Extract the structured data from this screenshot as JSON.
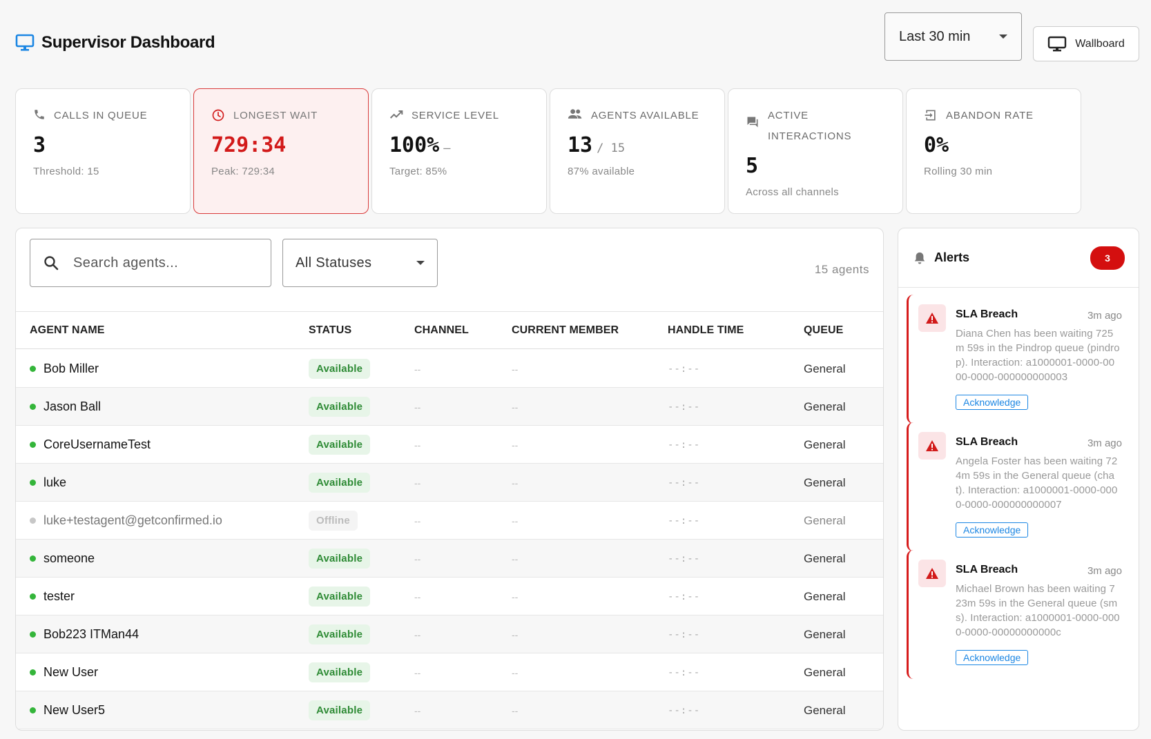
{
  "header": {
    "title": "Supervisor Dashboard",
    "time_range": "Last 30 min",
    "wallboard_label": "Wallboard"
  },
  "kpis": [
    {
      "label": "CALLS IN QUEUE",
      "value": "3",
      "secondary": "",
      "sub": "Threshold: 15",
      "icon": "phone-icon"
    },
    {
      "label": "LONGEST WAIT",
      "value": "729:34",
      "secondary": "",
      "sub": "Peak: 729:34",
      "icon": "clock-icon"
    },
    {
      "label": "SERVICE LEVEL",
      "value": "100%",
      "secondary": "–",
      "sub": "Target: 85%",
      "icon": "trend-icon"
    },
    {
      "label": "AGENTS AVAILABLE",
      "value": "13",
      "secondary": "/ 15",
      "sub": "87% available",
      "icon": "people-icon"
    },
    {
      "label": "ACTIVE INTERACTIONS",
      "value": "5",
      "secondary": "",
      "sub": "Across all channels",
      "icon": "chat-icon"
    },
    {
      "label": "ABANDON RATE",
      "value": "0%",
      "secondary": "",
      "sub": "Rolling 30 min",
      "icon": "exit-icon"
    }
  ],
  "agents": {
    "search_placeholder": "Search agents...",
    "status_filter": "All Statuses",
    "count_label": "15 agents",
    "columns": [
      "AGENT NAME",
      "STATUS",
      "CHANNEL",
      "CURRENT MEMBER",
      "HANDLE TIME",
      "QUEUE"
    ],
    "rows": [
      {
        "name": "Bob Miller",
        "status": "Available",
        "channel": "--",
        "member": "--",
        "handle": "--:--",
        "queue": "General"
      },
      {
        "name": "Jason Ball",
        "status": "Available",
        "channel": "--",
        "member": "--",
        "handle": "--:--",
        "queue": "General"
      },
      {
        "name": "CoreUsernameTest",
        "status": "Available",
        "channel": "--",
        "member": "--",
        "handle": "--:--",
        "queue": "General"
      },
      {
        "name": "luke",
        "status": "Available",
        "channel": "--",
        "member": "--",
        "handle": "--:--",
        "queue": "General"
      },
      {
        "name": "luke+testagent@getconfirmed.io",
        "status": "Offline",
        "channel": "--",
        "member": "--",
        "handle": "--:--",
        "queue": "General"
      },
      {
        "name": "someone",
        "status": "Available",
        "channel": "--",
        "member": "--",
        "handle": "--:--",
        "queue": "General"
      },
      {
        "name": "tester",
        "status": "Available",
        "channel": "--",
        "member": "--",
        "handle": "--:--",
        "queue": "General"
      },
      {
        "name": "Bob223 ITMan44",
        "status": "Available",
        "channel": "--",
        "member": "--",
        "handle": "--:--",
        "queue": "General"
      },
      {
        "name": "New User",
        "status": "Available",
        "channel": "--",
        "member": "--",
        "handle": "--:--",
        "queue": "General"
      },
      {
        "name": "New User5",
        "status": "Available",
        "channel": "--",
        "member": "--",
        "handle": "--:--",
        "queue": "General"
      }
    ]
  },
  "alerts": {
    "title": "Alerts",
    "count": "3",
    "items": [
      {
        "title": "SLA Breach",
        "time": "3m ago",
        "message": "Diana Chen has been waiting 725m 59s in the Pindrop queue (pindrop). Interaction: a1000001-0000-0000-0000-000000000003",
        "action": "Acknowledge"
      },
      {
        "title": "SLA Breach",
        "time": "3m ago",
        "message": "Angela Foster has been waiting 724m 59s in the General queue (chat). Interaction: a1000001-0000-0000-0000-000000000007",
        "action": "Acknowledge"
      },
      {
        "title": "SLA Breach",
        "time": "3m ago",
        "message": "Michael Brown has been waiting 723m 59s in the General queue (sms). Interaction: a1000001-0000-0000-0000-00000000000c",
        "action": "Acknowledge"
      }
    ]
  },
  "colors": {
    "accent": "#1b86e3",
    "danger": "#d21a1a",
    "available": "#34b53a",
    "offline": "#c7c7c7"
  }
}
